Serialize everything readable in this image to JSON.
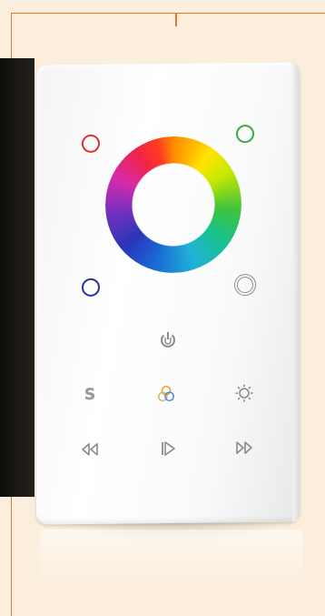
{
  "image": {
    "subject": "rgb-touch-panel",
    "panel": {
      "color_wheel": {
        "name": "color-wheel"
      },
      "corner_indicators": [
        {
          "name": "red-indicator",
          "color": "#e0302a"
        },
        {
          "name": "green-indicator",
          "color": "#37a93a"
        },
        {
          "name": "blue-indicator",
          "color": "#2a2fa0"
        },
        {
          "name": "white-indicator",
          "color": "#8c8c8c"
        }
      ],
      "buttons": {
        "power": {
          "icon": "power-icon"
        },
        "scene": {
          "icon": "scene-s-icon",
          "glyph": "S"
        },
        "rgb_mode": {
          "icon": "rgb-circles-icon"
        },
        "brightness": {
          "icon": "brightness-sun-icon"
        },
        "previous": {
          "icon": "rewind-icon"
        },
        "play": {
          "icon": "play-icon"
        },
        "next": {
          "icon": "fast-forward-icon"
        }
      }
    },
    "colors": {
      "background": "#fbeedd",
      "border_accent": "#e07a2e",
      "panel": "#ffffff",
      "icon_gray": "#8a8a8a"
    }
  }
}
